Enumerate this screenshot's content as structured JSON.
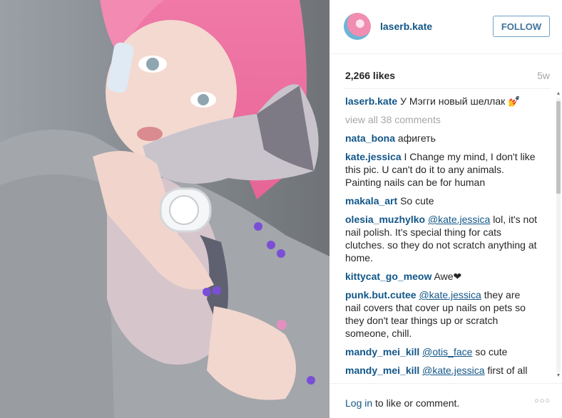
{
  "post": {
    "photo_alt": "pink haired girl holding sphynx cat"
  },
  "header": {
    "username": "laserb.kate",
    "follow_label": "FOLLOW"
  },
  "stats": {
    "likes": "2,266 likes",
    "age": "5w"
  },
  "caption": {
    "author": "laserb.kate",
    "text": "У Мэгги новый шеллак 💅"
  },
  "view_all": "view all 38 comments",
  "comments": [
    {
      "author": "nata_bona",
      "mention": "",
      "text": "афигеть"
    },
    {
      "author": "kate.jessica",
      "mention": "",
      "text": "I Change my mind, I don't like this pic. U can't do it to any animals. Painting nails can be for human"
    },
    {
      "author": "makala_art",
      "mention": "",
      "text": "So cute"
    },
    {
      "author": "olesia_muzhylko",
      "mention": "@kate.jessica",
      "text": "lol, it's not nail polish. It's special thing for cats clutches. so they do not scratch anything at home."
    },
    {
      "author": "kittycat_go_meow",
      "mention": "",
      "text": "Awe❤"
    },
    {
      "author": "punk.but.cutee",
      "mention": "@kate.jessica",
      "text": "they are nail covers that cover up nails on pets so they don't tear things up or scratch someone, chill."
    },
    {
      "author": "mandy_mei_kill",
      "mention": "@otis_face",
      "text": "so cute"
    },
    {
      "author": "mandy_mei_kill",
      "mention": "@kate.jessica",
      "text": "first of all there are nail polishes designed for pet"
    }
  ],
  "footer": {
    "login_link": "Log in",
    "login_rest": " to like or comment.",
    "more_symbol": "○○○"
  },
  "colors": {
    "link_blue": "#125688",
    "follow_blue": "#3f729b",
    "muted_gray": "#a5a7aa"
  }
}
